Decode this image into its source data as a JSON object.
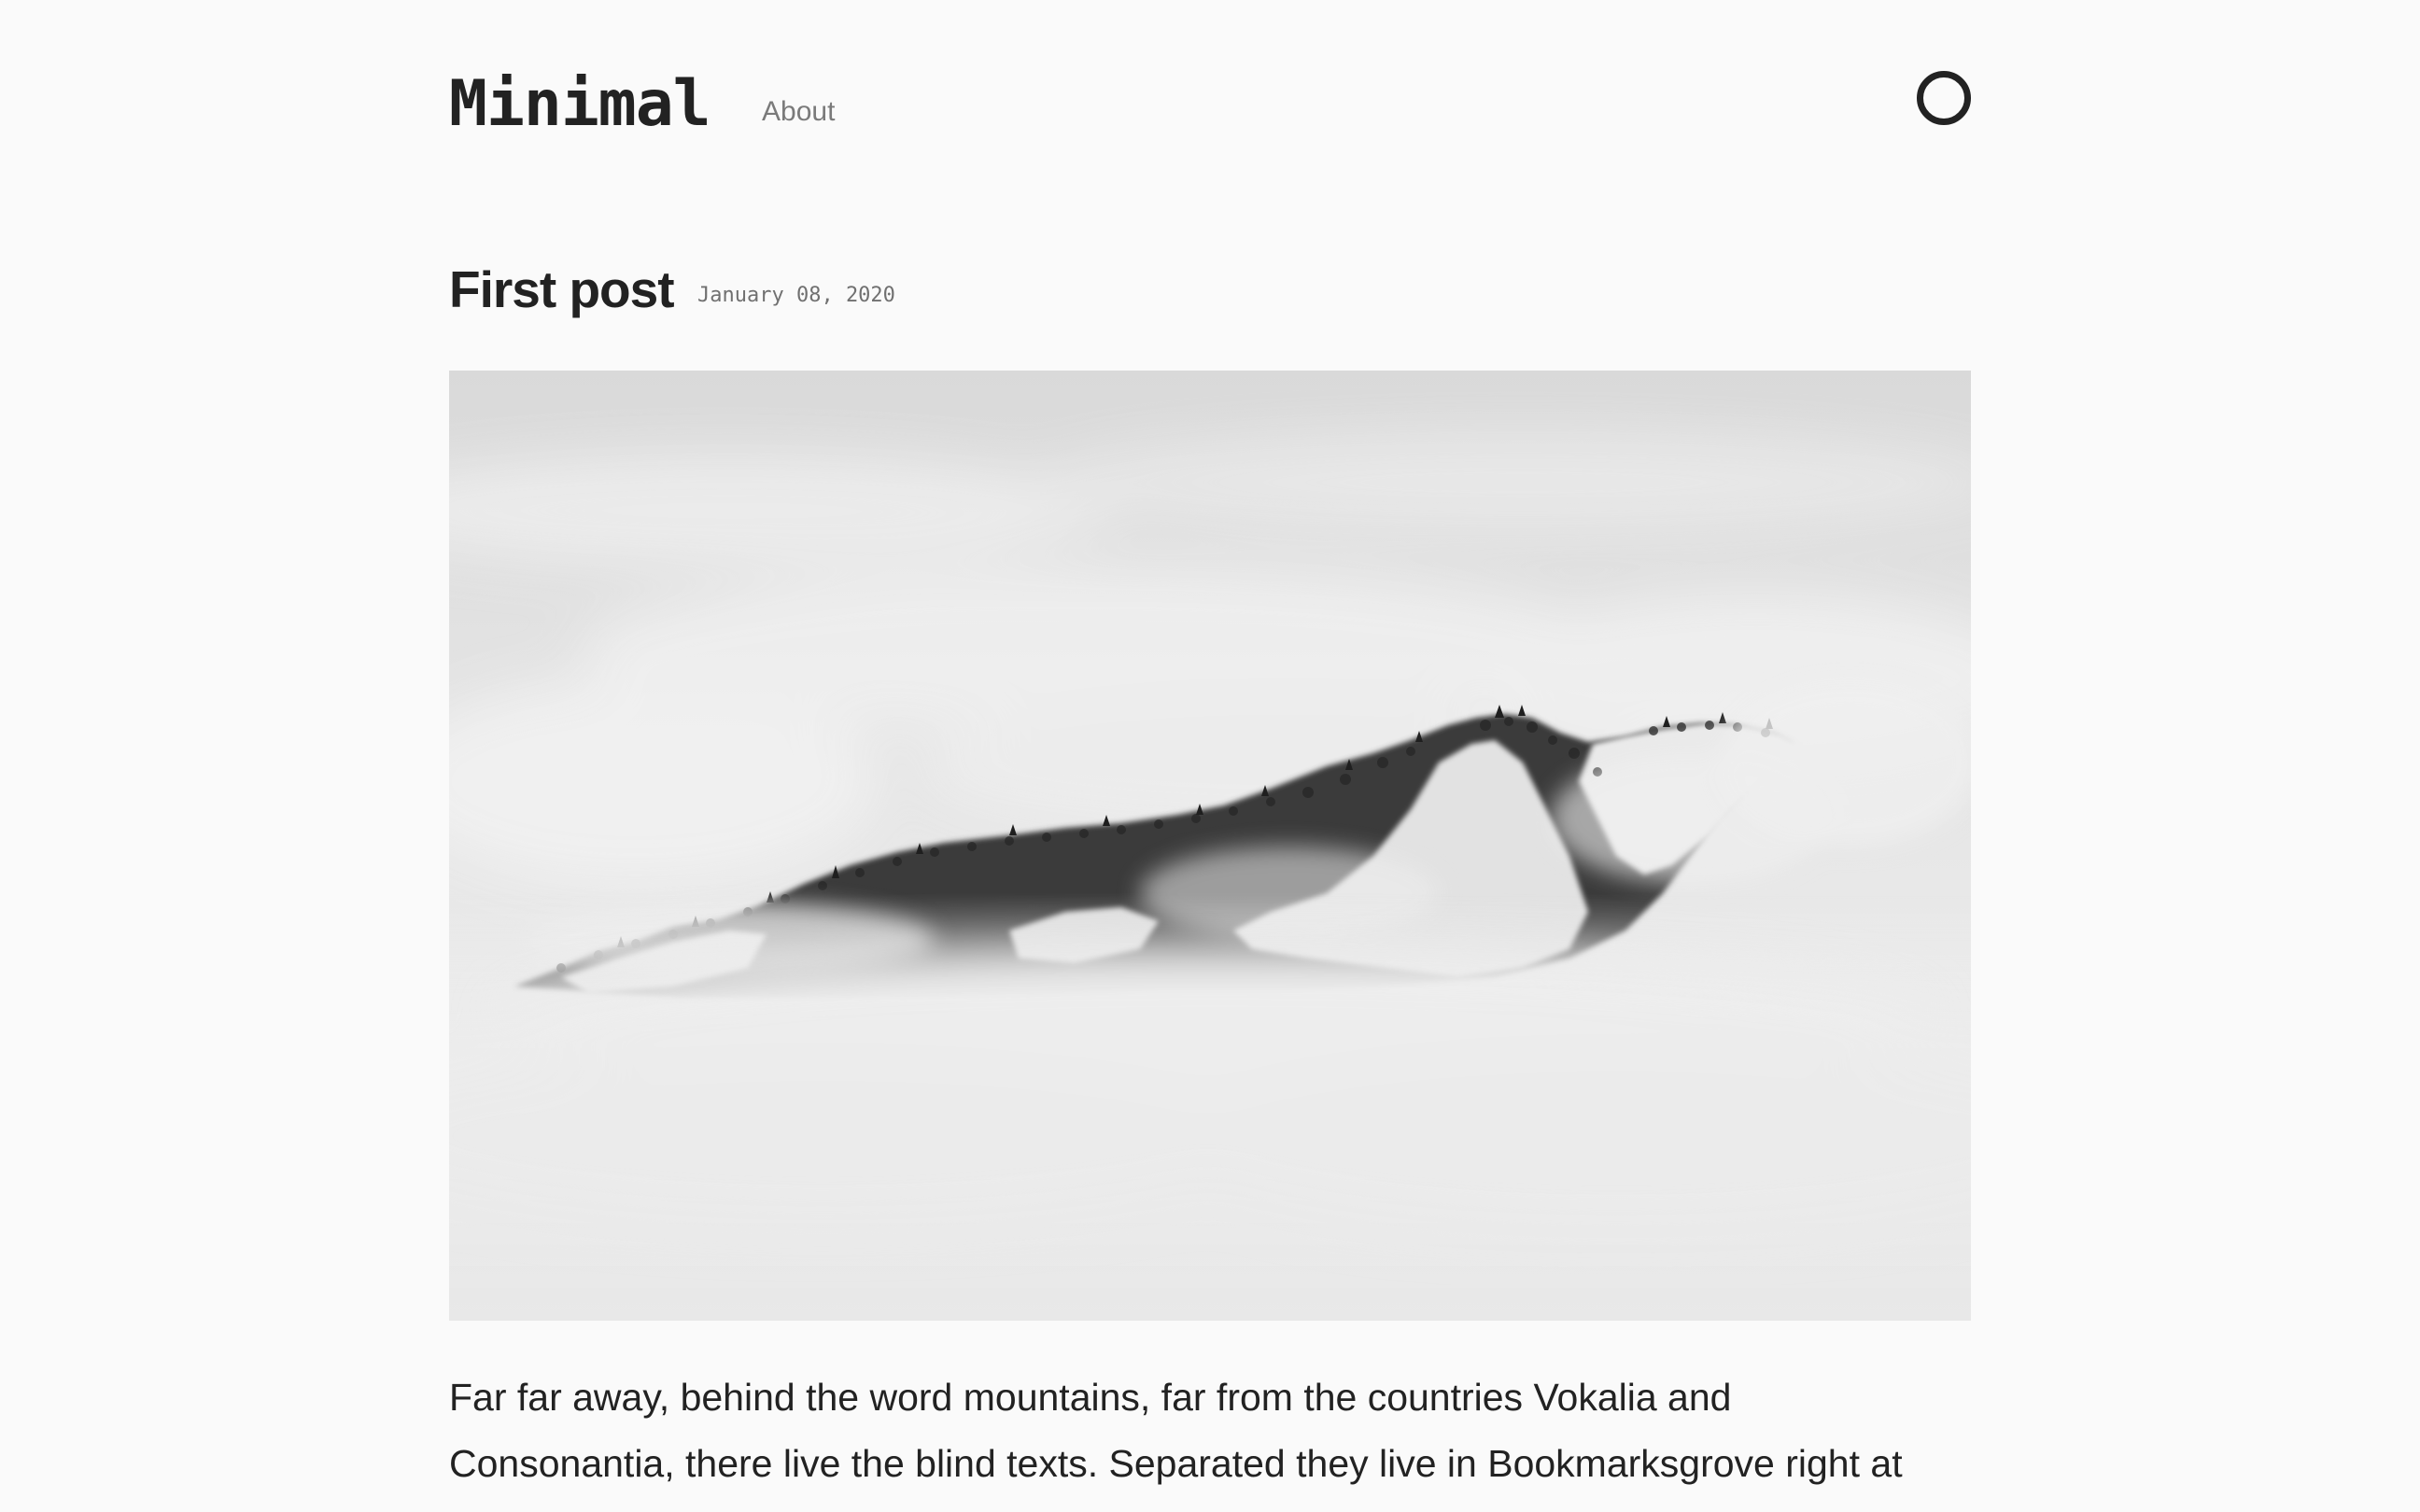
{
  "header": {
    "logo_text": "Minimal",
    "nav": [
      {
        "label": "About"
      }
    ],
    "theme_toggle_icon": "circle-icon"
  },
  "post": {
    "title": "First post",
    "date": "January 08, 2020",
    "image": {
      "icon": "snowy-mountain-in-fog-image"
    },
    "body_lines": [
      "Far far away, behind the word mountains, far from the countries Vokalia and",
      "Consonantia, there live the blind texts. Separated they live in Bookmarksgrove right at"
    ]
  },
  "colors": {
    "background": "#fafafa",
    "text": "#222222",
    "nav_text": "#7a7a7a",
    "date_text": "#707070"
  }
}
